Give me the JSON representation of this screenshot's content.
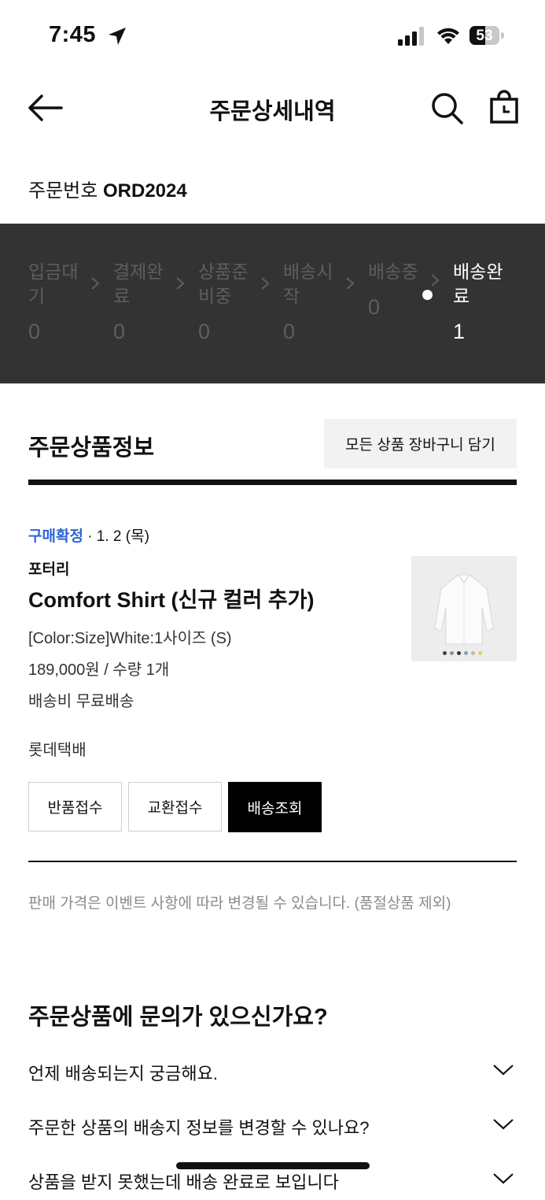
{
  "status_bar": {
    "time": "7:45",
    "battery": "53",
    "battery_level": 0.53
  },
  "header": {
    "title": "주문상세내역"
  },
  "order": {
    "number_label": "주문번호",
    "number_value": "ORD2024"
  },
  "progress": {
    "steps": [
      {
        "label": "입금대기",
        "count": "0"
      },
      {
        "label": "결제완료",
        "count": "0"
      },
      {
        "label": "상품준비중",
        "count": "0"
      },
      {
        "label": "배송시작",
        "count": "0"
      },
      {
        "label": "배송중",
        "count": "0"
      },
      {
        "label": "배송완료",
        "count": "1"
      }
    ]
  },
  "items_section": {
    "title": "주문상품정보",
    "cart_all_label": "모든 상품 장바구니 담기"
  },
  "item": {
    "status": "구매확정",
    "date": " · 1. 2 (목)",
    "brand": "포터리",
    "name": "Comfort Shirt (신규 컬러 추가)",
    "option": "[Color:Size]White:1사이즈 (S)",
    "price": "189,000원 / 수량 1개",
    "shipping": "배송비 무료배송",
    "courier": "롯데택배",
    "swatches": [
      "#3b4150",
      "#8a8f9c",
      "#2f3345",
      "#8c9fb8",
      "#c7b89a",
      "#e3c96e"
    ]
  },
  "actions": {
    "return_label": "반품접수",
    "exchange_label": "교환접수",
    "track_label": "배송조회"
  },
  "notice": "판매 가격은 이벤트 사항에 따라 변경될 수 있습니다. (품절상품 제외)",
  "faq": {
    "title": "주문상품에 문의가 있으신가요?",
    "items": [
      {
        "question": "언제 배송되는지 궁금해요."
      },
      {
        "question": "주문한 상품의 배송지 정보를 변경할 수 있나요?"
      },
      {
        "question": "상품을 받지 못했는데 배송 완료로 보입니다"
      }
    ]
  },
  "colors": {
    "accent_blue": "#2e64d6",
    "strip_bg": "#333333",
    "dark_button": "#000000"
  }
}
